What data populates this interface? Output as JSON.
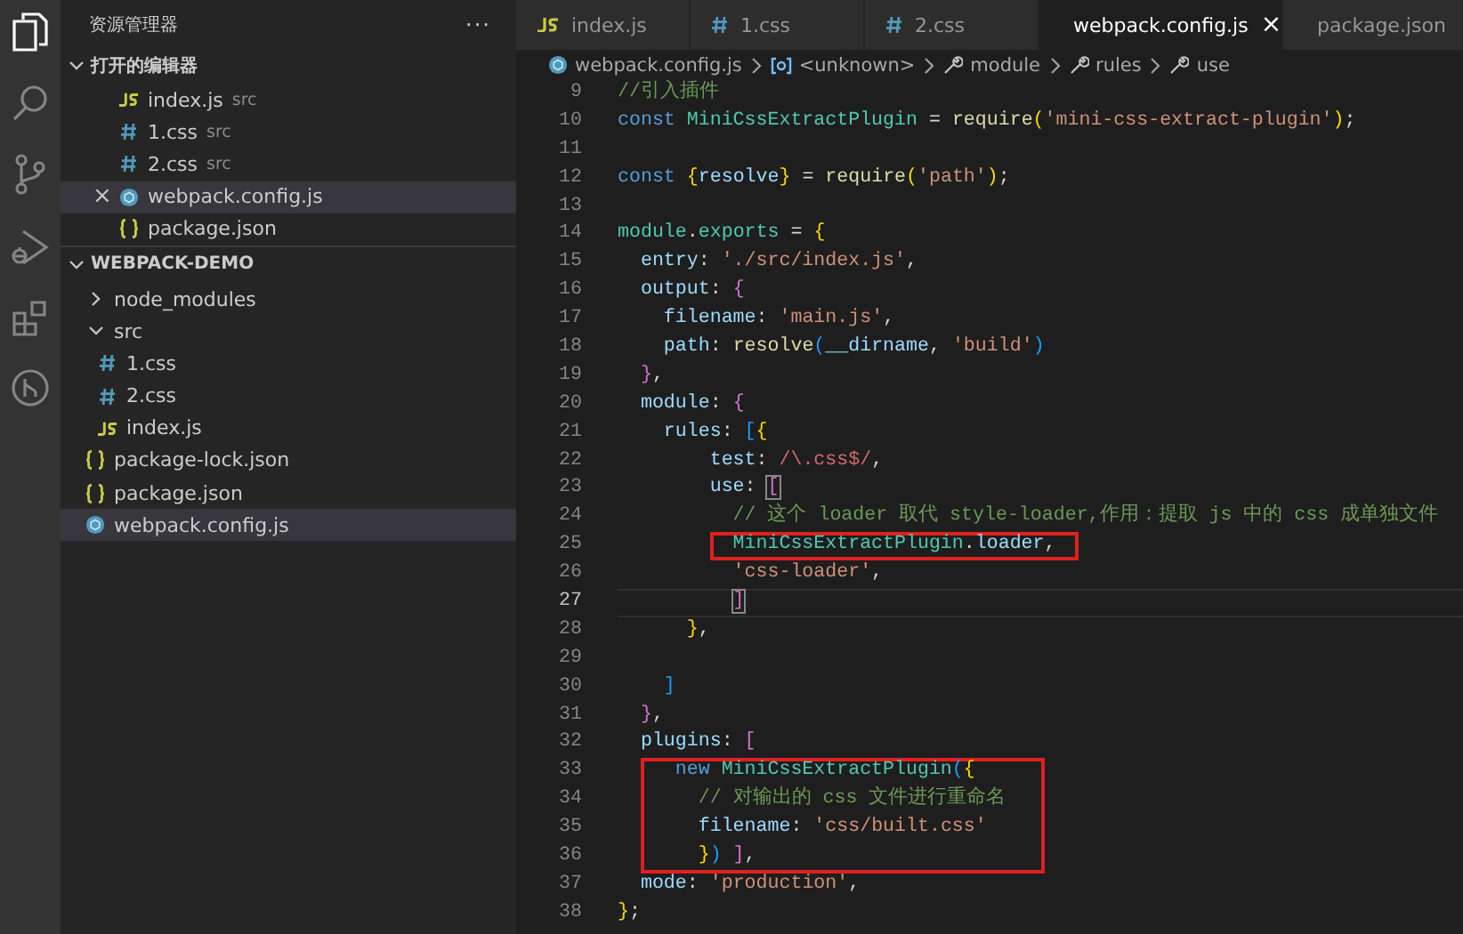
{
  "activity_bar": {
    "items": [
      {
        "kind": "files",
        "selected": true
      },
      {
        "kind": "search",
        "selected": false
      },
      {
        "kind": "source_control",
        "selected": false
      },
      {
        "kind": "run",
        "selected": false
      },
      {
        "kind": "extensions",
        "selected": false
      },
      {
        "kind": "remote",
        "selected": false
      }
    ]
  },
  "sidebar": {
    "title": "资源管理器",
    "more": "···",
    "open_editors": {
      "title": "打开的编辑器",
      "expanded": true,
      "items": [
        {
          "name": "index.js",
          "description": "src",
          "kind": "js",
          "selected": false
        },
        {
          "name": "1.css",
          "description": "src",
          "kind": "css",
          "selected": false
        },
        {
          "name": "2.css",
          "description": "src",
          "kind": "css",
          "selected": false
        },
        {
          "name": "webpack.config.js",
          "kind": "webpack",
          "selected": true,
          "close": "×"
        },
        {
          "name": "package.json",
          "kind": "json",
          "selected": false
        }
      ]
    },
    "project": {
      "title": "WEBPACK-DEMO",
      "expanded": true,
      "children": [
        {
          "name": "node_modules",
          "kind": "folder",
          "expanded": false,
          "selected": false
        },
        {
          "name": "src",
          "kind": "folder",
          "expanded": true,
          "selected": false,
          "children": [
            {
              "name": "1.css",
              "kind": "css",
              "selected": false
            },
            {
              "name": "2.css",
              "kind": "css",
              "selected": false
            },
            {
              "name": "index.js",
              "kind": "js",
              "selected": false
            }
          ]
        },
        {
          "name": "package-lock.json",
          "kind": "json",
          "selected": false
        },
        {
          "name": "package.json",
          "kind": "json",
          "selected": false
        },
        {
          "name": "webpack.config.js",
          "kind": "webpack",
          "selected": true
        }
      ]
    }
  },
  "tabs": [
    {
      "label": "index.js",
      "kind": "js",
      "selected": false
    },
    {
      "label": "1.css",
      "kind": "css",
      "selected": false
    },
    {
      "label": "2.css",
      "kind": "css",
      "selected": false
    },
    {
      "label": "webpack.config.js",
      "kind": "webpack",
      "selected": true,
      "close": "×"
    },
    {
      "label": "package.json",
      "kind": "json",
      "selected": false
    }
  ],
  "breadcrumbs": [
    {
      "label": "webpack.config.js",
      "kind": "webpack"
    },
    {
      "label": "<unknown>",
      "kind": "symbol"
    },
    {
      "label": "module",
      "kind": "wrench"
    },
    {
      "label": "rules",
      "kind": "wrench"
    },
    {
      "label": "use",
      "kind": "wrench"
    }
  ],
  "editor": {
    "lines": [
      {
        "number": "9",
        "tokens": [
          {
            "kind": "comment",
            "text": "//引入插件"
          }
        ]
      },
      {
        "number": "10",
        "tokens": [
          {
            "kind": "keyword",
            "text": "const "
          },
          {
            "kind": "class",
            "text": "MiniCssExtractPlugin"
          },
          {
            "kind": "punct",
            "text": " = "
          },
          {
            "kind": "function",
            "text": "require"
          },
          {
            "kind": "bracket1",
            "text": "("
          },
          {
            "kind": "string",
            "text": "'mini-css-extract-plugin'"
          },
          {
            "kind": "bracket1",
            "text": ")"
          },
          {
            "kind": "punct",
            "text": ";"
          }
        ]
      },
      {
        "number": "11"
      },
      {
        "number": "12",
        "tokens": [
          {
            "kind": "keyword",
            "text": "const "
          },
          {
            "kind": "bracket1",
            "text": "{"
          },
          {
            "kind": "variable",
            "text": "resolve"
          },
          {
            "kind": "bracket1",
            "text": "}"
          },
          {
            "kind": "punct",
            "text": " = "
          },
          {
            "kind": "function",
            "text": "require"
          },
          {
            "kind": "bracket1",
            "text": "("
          },
          {
            "kind": "string",
            "text": "'path'"
          },
          {
            "kind": "bracket1",
            "text": ")"
          },
          {
            "kind": "punct",
            "text": ";"
          }
        ]
      },
      {
        "number": "13"
      },
      {
        "number": "14",
        "tokens": [
          {
            "kind": "class",
            "text": "module"
          },
          {
            "kind": "punct",
            "text": "."
          },
          {
            "kind": "class",
            "text": "exports"
          },
          {
            "kind": "punct",
            "text": " = "
          },
          {
            "kind": "bracket1",
            "text": "{"
          }
        ]
      },
      {
        "number": "15",
        "tokens": [
          {
            "kind": "variable",
            "text": "  entry"
          },
          {
            "kind": "punct",
            "text": ": "
          },
          {
            "kind": "string",
            "text": "'./src/index.js'"
          },
          {
            "kind": "punct",
            "text": ","
          }
        ]
      },
      {
        "number": "16",
        "tokens": [
          {
            "kind": "variable",
            "text": "  output"
          },
          {
            "kind": "punct",
            "text": ": "
          },
          {
            "kind": "bracket2",
            "text": "{"
          }
        ]
      },
      {
        "number": "17",
        "tokens": [
          {
            "kind": "variable",
            "text": "    filename"
          },
          {
            "kind": "punct",
            "text": ": "
          },
          {
            "kind": "string",
            "text": "'main.js'"
          },
          {
            "kind": "punct",
            "text": ","
          }
        ]
      },
      {
        "number": "18",
        "tokens": [
          {
            "kind": "variable",
            "text": "    path"
          },
          {
            "kind": "punct",
            "text": ": "
          },
          {
            "kind": "function",
            "text": "resolve"
          },
          {
            "kind": "bracket3",
            "text": "("
          },
          {
            "kind": "variable",
            "text": "__dirname"
          },
          {
            "kind": "punct",
            "text": ", "
          },
          {
            "kind": "string",
            "text": "'build'"
          },
          {
            "kind": "bracket3",
            "text": ")"
          }
        ]
      },
      {
        "number": "19",
        "tokens": [
          {
            "kind": "bracket2",
            "text": "  }"
          },
          {
            "kind": "punct",
            "text": ","
          }
        ]
      },
      {
        "number": "20",
        "tokens": [
          {
            "kind": "variable",
            "text": "  module"
          },
          {
            "kind": "punct",
            "text": ": "
          },
          {
            "kind": "bracket2",
            "text": "{"
          }
        ]
      },
      {
        "number": "21",
        "tokens": [
          {
            "kind": "variable",
            "text": "    rules"
          },
          {
            "kind": "punct",
            "text": ": "
          },
          {
            "kind": "bracket3",
            "text": "["
          },
          {
            "kind": "bracket1",
            "text": "{"
          }
        ]
      },
      {
        "number": "22",
        "tokens": [
          {
            "kind": "variable",
            "text": "        test"
          },
          {
            "kind": "punct",
            "text": ": "
          },
          {
            "kind": "regex",
            "text": "/\\.css$/"
          },
          {
            "kind": "punct",
            "text": ","
          }
        ]
      },
      {
        "number": "23",
        "tokens": [
          {
            "kind": "variable",
            "text": "        use"
          },
          {
            "kind": "punct",
            "text": ": "
          },
          {
            "kind": "bracket_match",
            "text": "["
          }
        ]
      },
      {
        "number": "24",
        "tokens": [
          {
            "kind": "comment",
            "text": "          // 这个 loader 取代 style-loader,作用：提取 js 中的 css 成单独文件"
          }
        ]
      },
      {
        "number": "25",
        "boxed": true,
        "tokens": [
          {
            "kind": "class",
            "text": "          MiniCssExtractPlugin"
          },
          {
            "kind": "punct",
            "text": "."
          },
          {
            "kind": "variable",
            "text": "loader"
          },
          {
            "kind": "punct",
            "text": ","
          }
        ]
      },
      {
        "number": "26",
        "tokens": [
          {
            "kind": "string",
            "text": "          'css-loader'"
          },
          {
            "kind": "punct",
            "text": ","
          }
        ]
      },
      {
        "number": "27",
        "current": true,
        "tokens": [
          {
            "kind": "bracket_match",
            "text": "          ]"
          }
        ]
      },
      {
        "number": "28",
        "tokens": [
          {
            "kind": "bracket1",
            "text": "      }"
          },
          {
            "kind": "punct",
            "text": ","
          }
        ]
      },
      {
        "number": "29"
      },
      {
        "number": "30",
        "tokens": [
          {
            "kind": "bracket3",
            "text": "    ]"
          }
        ]
      },
      {
        "number": "31",
        "tokens": [
          {
            "kind": "bracket2",
            "text": "  }"
          },
          {
            "kind": "punct",
            "text": ","
          }
        ]
      },
      {
        "number": "32",
        "tokens": [
          {
            "kind": "variable",
            "text": "  plugins"
          },
          {
            "kind": "punct",
            "text": ": "
          },
          {
            "kind": "bracket2",
            "text": "["
          }
        ]
      },
      {
        "number": "33",
        "boxed": true,
        "tokens": [
          {
            "kind": "keyword",
            "text": "     new "
          },
          {
            "kind": "class",
            "text": "MiniCssExtractPlugin"
          },
          {
            "kind": "bracket3",
            "text": "("
          },
          {
            "kind": "bracket1",
            "text": "{"
          }
        ]
      },
      {
        "number": "34",
        "boxed": true,
        "tokens": [
          {
            "kind": "comment",
            "text": "       // 对输出的 css 文件进行重命名"
          }
        ]
      },
      {
        "number": "35",
        "boxed": true,
        "tokens": [
          {
            "kind": "variable",
            "text": "       filename"
          },
          {
            "kind": "punct",
            "text": ": "
          },
          {
            "kind": "string",
            "text": "'css/built.css'"
          }
        ]
      },
      {
        "number": "36",
        "boxed": true,
        "tokens": [
          {
            "kind": "bracket1",
            "text": "       }"
          },
          {
            "kind": "bracket3",
            "text": ")"
          },
          {
            "kind": "bracket2",
            "text": " ]"
          },
          {
            "kind": "punct",
            "text": ","
          }
        ]
      },
      {
        "number": "37",
        "tokens": [
          {
            "kind": "variable",
            "text": "  mode"
          },
          {
            "kind": "punct",
            "text": ": "
          },
          {
            "kind": "string",
            "text": "'production'"
          },
          {
            "kind": "punct",
            "text": ","
          }
        ]
      },
      {
        "number": "38",
        "tokens": [
          {
            "kind": "bracket1",
            "text": "}"
          },
          {
            "kind": "punct",
            "text": ";"
          }
        ]
      }
    ]
  }
}
